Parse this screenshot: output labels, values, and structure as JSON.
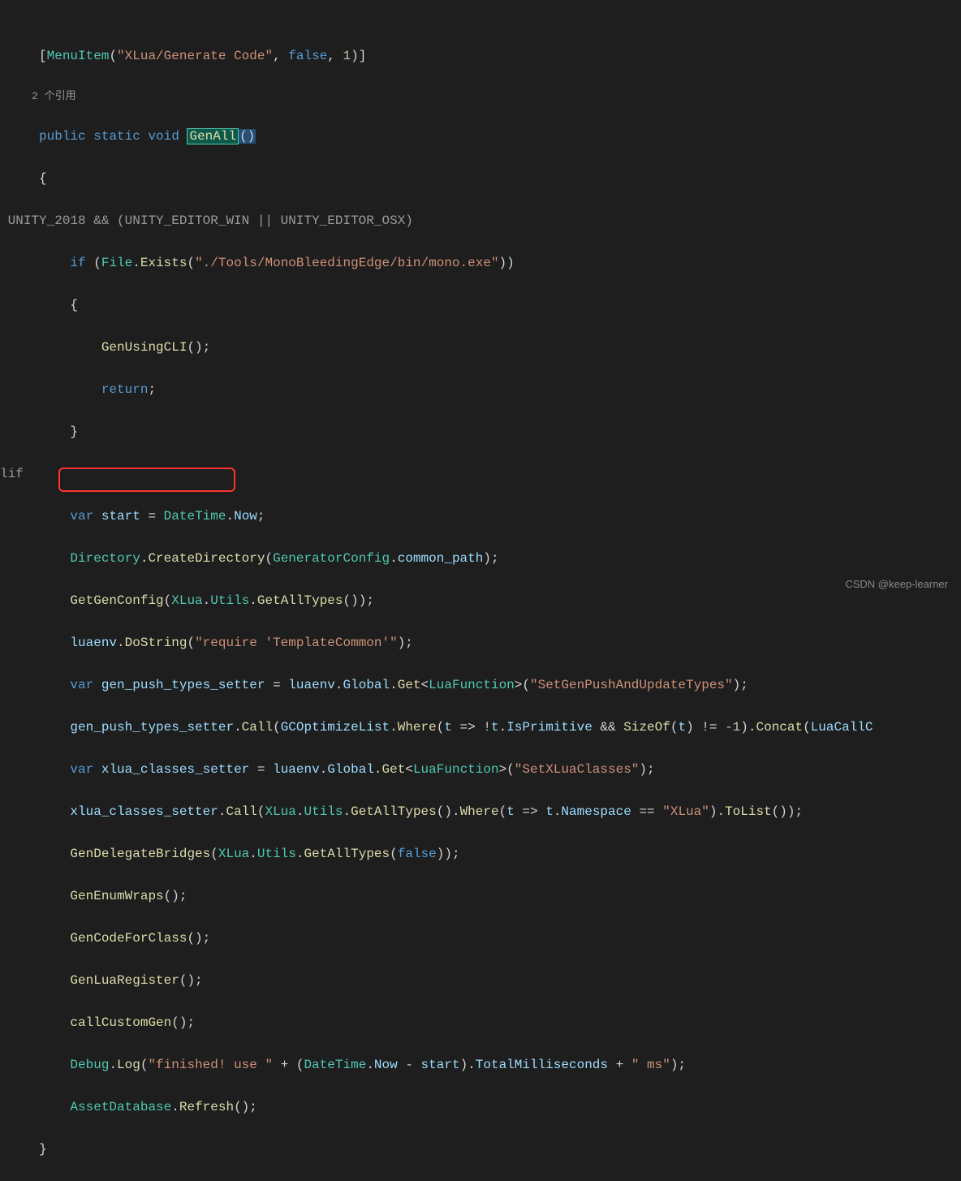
{
  "attribute_open": "[",
  "menuitem_type": "MenuItem",
  "menuitem_path": "\"XLua/Generate Code\"",
  "menuitem_false": "false",
  "menuitem_one": "1",
  "attribute_close": ")]",
  "codelens_refs": "2 个引用",
  "kw_public": "public",
  "kw_static": "static",
  "kw_void": "void",
  "method_genall": "GenAll",
  "paren_pair": "()",
  "brace_open": "{",
  "brace_close": "}",
  "pp_line": "UNITY_2018 && (UNITY_EDITOR_WIN || UNITY_EDITOR_OSX)",
  "pp_lif": "lif",
  "kw_if": "if",
  "file_type": "File",
  "exists_method": "Exists",
  "mono_path": "\"./Tools/MonoBleedingEdge/bin/mono.exe\"",
  "gen_using_cli": "GenUsingCLI",
  "kw_return": "return",
  "kw_var": "var",
  "var_start": "start",
  "datetime_type": "DateTime",
  "now_prop": "Now",
  "directory_type": "Directory",
  "create_dir": "CreateDirectory",
  "gencfg_type": "GeneratorConfig",
  "common_path": "common_path",
  "get_gen_config": "GetGenConfig",
  "xlua_type": "XLua",
  "utils_type": "Utils",
  "get_all_types": "GetAllTypes",
  "luaenv_var": "luaenv",
  "dostring": "DoString",
  "require_tmpl": "\"require 'TemplateCommon'\"",
  "gen_push_types_setter": "gen_push_types_setter",
  "global_prop": "Global",
  "get_method": "Get",
  "luafunction_type": "LuaFunction",
  "set_gen_push": "\"SetGenPushAndUpdateTypes\"",
  "call_method": "Call",
  "gcopt_type": "GCOptimizeList",
  "where_method": "Where",
  "lambda_t": "t",
  "isprimitive": "IsPrimitive",
  "sizeof_method": "SizeOf",
  "amp_amp": "&&",
  "neq_neg1": "!= -1",
  "concat_method": "Concat",
  "luacall_partial": "LuaCallC",
  "xlua_classes_setter": "xlua_classes_setter",
  "set_xlua_classes": "\"SetXLuaClasses\"",
  "namespace_prop": "Namespace",
  "xlua_str": "\"XLua\"",
  "tolist_method": "ToList",
  "gen_delegate_bridges": "GenDelegateBridges",
  "gen_enum_wraps": "GenEnumWraps",
  "gen_code_for_class": "GenCodeForClass",
  "gen_lua_register": "GenLuaRegister",
  "call_custom_gen": "callCustomGen",
  "debug_type": "Debug",
  "log_method": "Log",
  "finished_str": "\"finished! use \"",
  "total_ms": "TotalMilliseconds",
  "ms_str": "\" ms\"",
  "assetdb_type": "AssetDatabase",
  "refresh_method": "Refresh",
  "watermark_text": "CSDN @keep-learner"
}
